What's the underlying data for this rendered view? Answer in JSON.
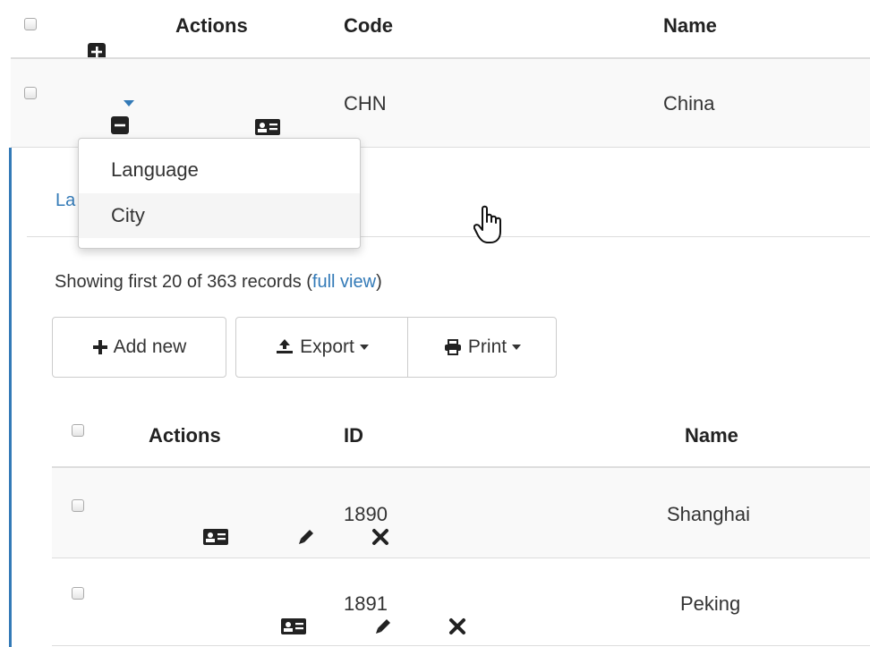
{
  "parent_table": {
    "headers": {
      "actions": "Actions",
      "code": "Code",
      "name": "Name"
    },
    "row": {
      "code": "CHN",
      "name": "China"
    }
  },
  "detail_tabs": {
    "partial_label": "La"
  },
  "detail_menu": {
    "items": [
      "Language",
      "City"
    ],
    "hovered": "City"
  },
  "child_panel": {
    "summary_prefix": "Showing first 20 of 363 records (",
    "summary_link": "full view",
    "summary_suffix": ")",
    "toolbar": {
      "add_label": "Add new",
      "export_label": "Export",
      "print_label": "Print"
    },
    "headers": {
      "actions": "Actions",
      "id": "ID",
      "name": "Name"
    },
    "rows": [
      {
        "id": "1890",
        "name": "Shanghai"
      },
      {
        "id": "1891",
        "name": "Peking"
      }
    ]
  },
  "colors": {
    "accent": "#337ab7",
    "row_shade": "#f9f9f9",
    "menu_hover": "#f5f5f5"
  },
  "icons": [
    "plus-square-icon",
    "minus-square-icon",
    "caret-down-icon",
    "id-card-icon",
    "pencil-icon",
    "close-icon",
    "plus-icon",
    "export-icon",
    "print-icon",
    "hand-cursor-icon"
  ]
}
